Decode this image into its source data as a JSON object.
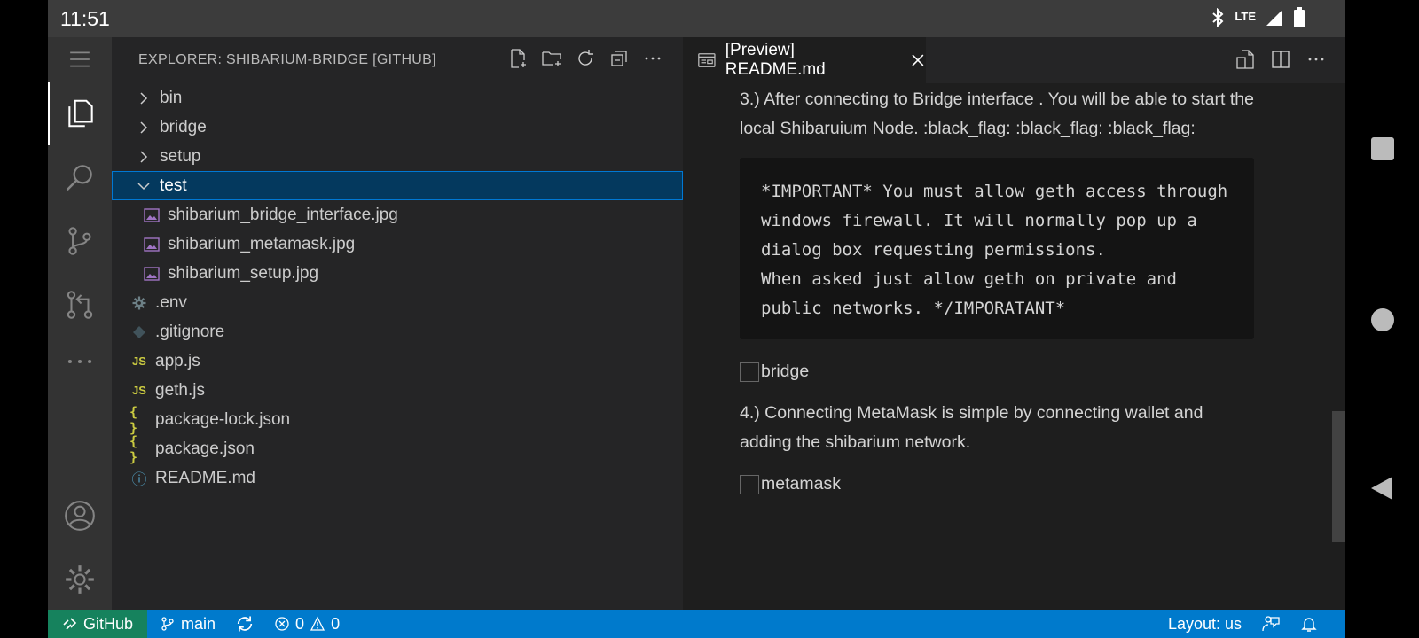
{
  "phone": {
    "time": "11:51",
    "network": "LTE"
  },
  "sidebar": {
    "title": "EXPLORER: SHIBARIUM-BRIDGE [GITHUB]",
    "items": [
      {
        "label": "bin",
        "type": "folder",
        "expanded": false
      },
      {
        "label": "bridge",
        "type": "folder",
        "expanded": false
      },
      {
        "label": "setup",
        "type": "folder",
        "expanded": false
      },
      {
        "label": "test",
        "type": "folder",
        "expanded": true,
        "selected": true
      },
      {
        "label": "shibarium_bridge_interface.jpg",
        "type": "image"
      },
      {
        "label": "shibarium_metamask.jpg",
        "type": "image"
      },
      {
        "label": "shibarium_setup.jpg",
        "type": "image"
      },
      {
        "label": ".env",
        "type": "gear"
      },
      {
        "label": ".gitignore",
        "type": "git"
      },
      {
        "label": "app.js",
        "type": "js",
        "icon_text": "JS"
      },
      {
        "label": "geth.js",
        "type": "js",
        "icon_text": "JS"
      },
      {
        "label": "package-lock.json",
        "type": "json",
        "icon_text": "{ }"
      },
      {
        "label": "package.json",
        "type": "json",
        "icon_text": "{ }"
      },
      {
        "label": "README.md",
        "type": "info",
        "icon_text": "ⓘ"
      }
    ]
  },
  "editor": {
    "tab_label": "[Preview] README.md",
    "preview": {
      "p1": "3.) After connecting to Bridge interface . You will be able to start the local Shibaruium Node. :black_flag: :black_flag: :black_flag:",
      "code": "*IMPORTANT* You must allow geth access through windows firewall. It will normally pop up a dialog box requesting permissions.\nWhen asked just allow geth on private and public networks. */IMPORATANT*",
      "img1_alt": "bridge",
      "p2": "4.) Connecting MetaMask is simple by connecting wallet and adding the shibarium network.",
      "img2_alt": "metamask"
    }
  },
  "statusbar": {
    "remote": "GitHub",
    "branch": "main",
    "errors": "0",
    "warnings": "0",
    "layout": "Layout: us"
  },
  "colors": {
    "accent": "#007acc",
    "remote": "#16825d",
    "selection": "#04395e"
  }
}
